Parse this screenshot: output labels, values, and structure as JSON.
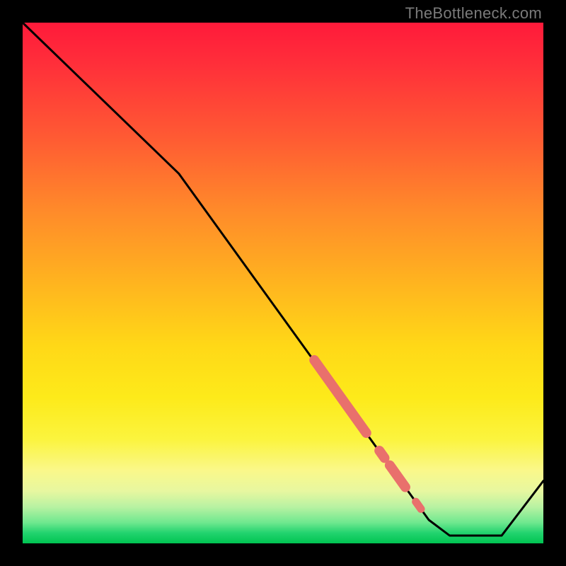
{
  "watermark": "TheBottleneck.com",
  "colors": {
    "frame": "#000000",
    "curve": "#000000",
    "highlight": "#e9706c"
  },
  "chart_data": {
    "type": "line",
    "title": "",
    "xlabel": "",
    "ylabel": "",
    "xlim": [
      0,
      100
    ],
    "ylim": [
      0,
      100
    ],
    "grid": false,
    "legend": false,
    "series": [
      {
        "name": "bottleneck-curve",
        "x": [
          0,
          30,
          78,
          82,
          92,
          100
        ],
        "y": [
          100,
          71,
          4.5,
          1.5,
          1.5,
          12
        ]
      }
    ],
    "highlighted_segments": [
      {
        "x0": 56,
        "y0": 35.2,
        "x1": 66,
        "y1": 21.2,
        "thick": true
      },
      {
        "x0": 68.5,
        "y0": 17.8,
        "x1": 69.5,
        "y1": 16.4,
        "thick": true
      },
      {
        "x0": 70.5,
        "y0": 15.0,
        "x1": 73.5,
        "y1": 10.8,
        "thick": true
      },
      {
        "x0": 75.5,
        "y0": 8.0,
        "x1": 76.5,
        "y1": 6.6,
        "thick": false
      }
    ],
    "annotations": []
  }
}
